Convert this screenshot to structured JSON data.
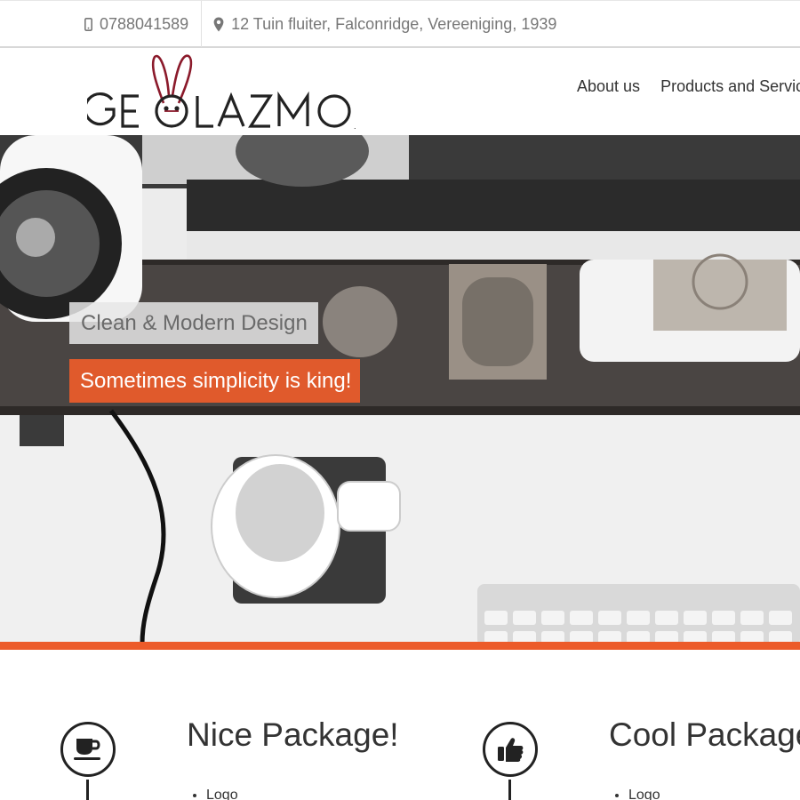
{
  "topbar": {
    "phone": "0788041589",
    "address": "12 Tuin fluiter, Falconridge, Vereeniging, 1939",
    "phone_icon": "mobile-phone-icon",
    "address_icon": "map-marker-icon"
  },
  "brand": {
    "logo_text": "GEOLAZMO",
    "logo_accent_color": "#8b1a2b"
  },
  "nav": {
    "items": [
      {
        "label": "About us"
      },
      {
        "label": "Products and Services"
      }
    ]
  },
  "hero": {
    "caption_primary": "Clean & Modern Design",
    "caption_secondary": "Sometimes simplicity is king!",
    "accent_color": "#ec5b2a"
  },
  "packages": [
    {
      "title": "Nice Package!",
      "icon": "coffee-cup-icon",
      "items": [
        "Logo"
      ]
    },
    {
      "title": "Cool Package",
      "icon": "thumbs-up-icon",
      "items": [
        "Logo"
      ]
    }
  ]
}
